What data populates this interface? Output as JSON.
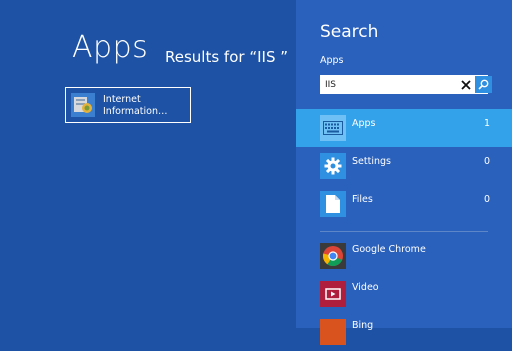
{
  "main": {
    "title": "Apps",
    "results_text": "Results for “IIS ”",
    "result": {
      "line1": "Internet",
      "line2": "Information…",
      "icon": "iis-manager-icon"
    }
  },
  "search_pane": {
    "title": "Search",
    "scope_label": "Apps",
    "query": "IIS",
    "filters": [
      {
        "label": "Apps",
        "count": "1",
        "icon": "keyboard-icon",
        "active": true
      },
      {
        "label": "Settings",
        "count": "0",
        "icon": "gear-icon",
        "active": false
      },
      {
        "label": "Files",
        "count": "0",
        "icon": "file-icon",
        "active": false
      }
    ],
    "apps": [
      {
        "label": "Google Chrome",
        "icon": "chrome-icon"
      },
      {
        "label": "Video",
        "icon": "video-icon"
      },
      {
        "label": "Bing",
        "icon": "bing-icon"
      }
    ]
  },
  "colors": {
    "background": "#1d52a5",
    "pane": "#2a61bd",
    "active_filter": "#34a2ea",
    "tile_icon": "#2f8fe0"
  }
}
